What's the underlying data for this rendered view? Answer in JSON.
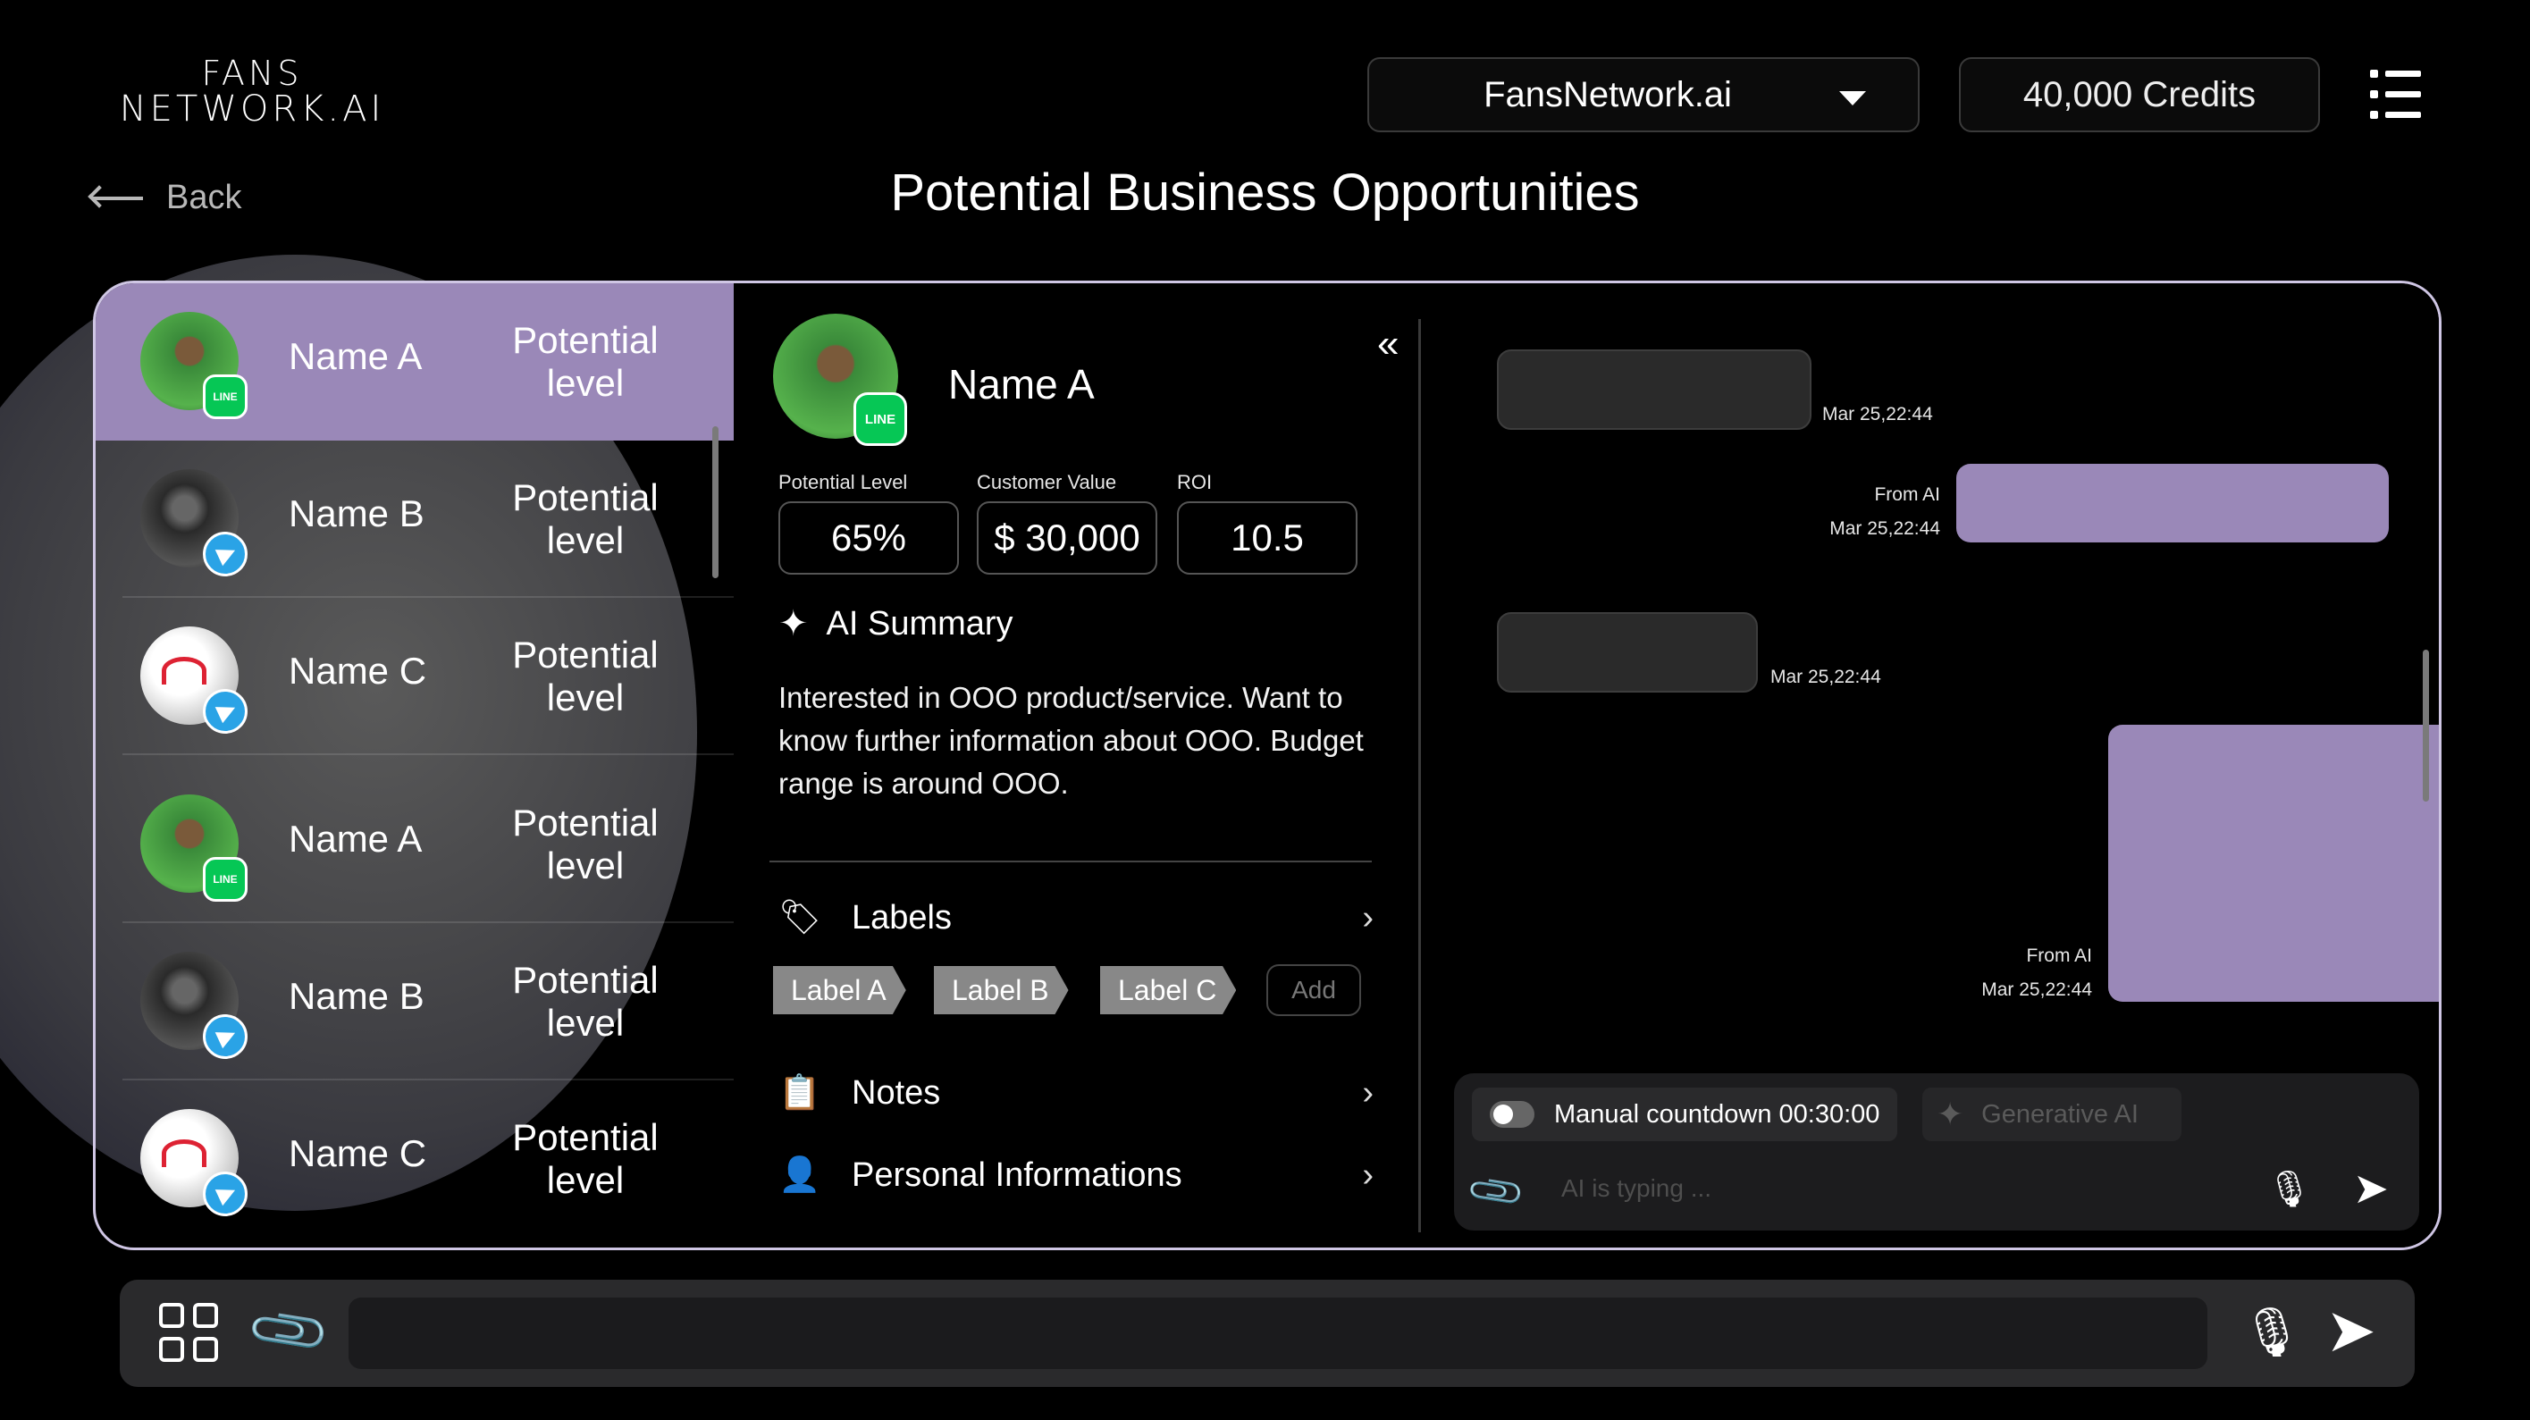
{
  "header": {
    "logo_line1": "FANS",
    "logo_line2": "NETWORK.AI",
    "workspace": "FansNetwork.ai",
    "credits": "40,000 Credits",
    "back_label": "Back",
    "page_title": "Potential Business Opportunities"
  },
  "contacts": [
    {
      "name": "Name A",
      "level": "Potential level",
      "channel": "LINE"
    },
    {
      "name": "Name B",
      "level": "Potential level",
      "channel": "telegram"
    },
    {
      "name": "Name C",
      "level": "Potential level",
      "channel": "telegram"
    },
    {
      "name": "Name A",
      "level": "Potential level",
      "channel": "LINE"
    },
    {
      "name": "Name B",
      "level": "Potential level",
      "channel": "telegram"
    },
    {
      "name": "Name C",
      "level": "Potential level",
      "channel": "telegram"
    }
  ],
  "detail": {
    "name": "Name A",
    "badge": "LINE",
    "metrics": {
      "potential_label": "Potential Level",
      "potential_value": "65%",
      "customer_label": "Customer Value",
      "customer_value": "$ 30,000",
      "roi_label": "ROI",
      "roi_value": "10.5"
    },
    "ai_summary_title": "AI Summary",
    "ai_summary_text": "Interested in OOO product/service. Want to know further information about OOO. Budget range is around OOO.",
    "labels_title": "Labels",
    "labels": [
      "Label A",
      "Label B",
      "Label C"
    ],
    "add_label": "Add",
    "notes_title": "Notes",
    "personal_title": "Personal Informations"
  },
  "chat": {
    "messages": [
      {
        "from": "",
        "time": "Mar 25,22:44"
      },
      {
        "from": "From AI",
        "time": "Mar 25,22:44"
      },
      {
        "from": "",
        "time": "Mar 25,22:44"
      },
      {
        "from": "From AI",
        "time": "Mar 25,22:44"
      }
    ],
    "countdown": "Manual countdown 00:30:00",
    "generative": "Generative AI",
    "placeholder": "AI is typing ..."
  },
  "colors": {
    "accent": "#9a88b8",
    "line_green": "#06c755",
    "telegram_blue": "#2aa3e6"
  }
}
